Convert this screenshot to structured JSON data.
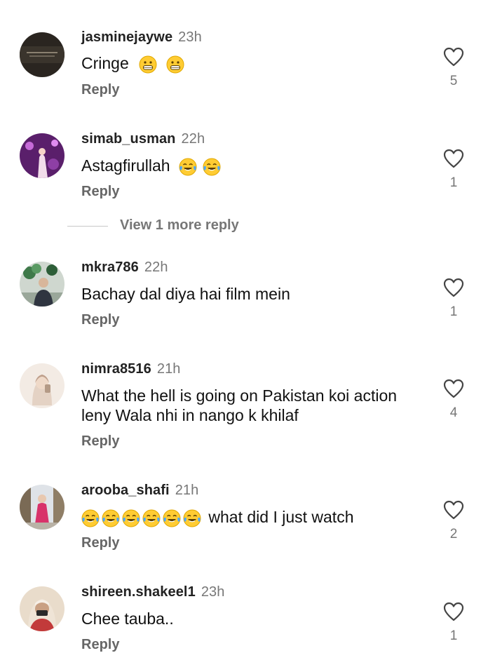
{
  "comments": [
    {
      "username": "jasminejaywe",
      "time": "23h",
      "text": "Cringe",
      "emojis": [
        "grimace",
        "grimace"
      ],
      "reply": "Reply",
      "likes": "5"
    },
    {
      "username": "simab_usman",
      "time": "22h",
      "text": "Astagfirullah",
      "emojis": [
        "joy",
        "joy"
      ],
      "reply": "Reply",
      "likes": "1"
    },
    {
      "username": "mkra786",
      "time": "22h",
      "text": "Bachay dal diya hai film mein",
      "emojis": [],
      "reply": "Reply",
      "likes": "1"
    },
    {
      "username": "nimra8516",
      "time": "21h",
      "text": "What the hell is going on Pakistan koi action leny Wala nhi in nango k khilaf",
      "emojis": [],
      "reply": "Reply",
      "likes": "4"
    },
    {
      "username": "arooba_shafi",
      "time": "21h",
      "text": "what did I just watch",
      "emojis_before": [
        "joy",
        "joy",
        "joy",
        "joy",
        "joy",
        "joy"
      ],
      "reply": "Reply",
      "likes": "2"
    },
    {
      "username": "shireen.shakeel1",
      "time": "23h",
      "text": "Chee tauba..",
      "emojis": [],
      "reply": "Reply",
      "likes": "1"
    }
  ],
  "view_more_replies": "View 1 more reply",
  "icons": {
    "like": "heart-outline-icon",
    "emoji_grimace": "grimacing-face-icon",
    "emoji_joy": "tears-of-joy-icon"
  }
}
